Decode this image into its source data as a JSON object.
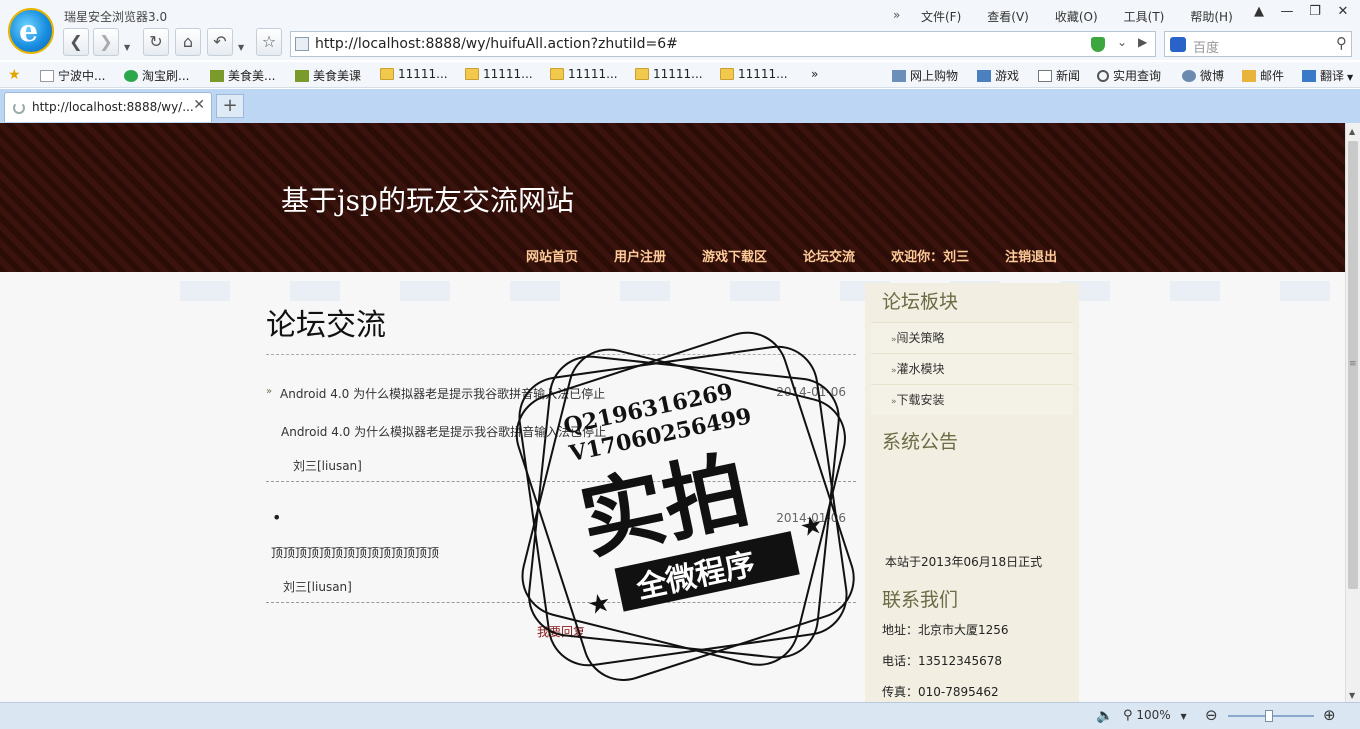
{
  "browser": {
    "app_title": "瑞星安全浏览器3.0",
    "menus": [
      "文件(F)",
      "查看(V)",
      "收藏(O)",
      "工具(T)",
      "帮助(H)"
    ],
    "menu_more": "»",
    "url": "http://localhost:8888/wy/huifuAll.action?zhutiId=6#",
    "search_placeholder": "百度",
    "favorites": [
      {
        "label": "宁波中...",
        "icon": "page-icon"
      },
      {
        "label": "淘宝刷...",
        "icon": "taobao-icon"
      },
      {
        "label": "美食美...",
        "icon": "site-icon"
      },
      {
        "label": "美食美课",
        "icon": "site-icon"
      },
      {
        "label": "11111...",
        "icon": "folder-icon"
      },
      {
        "label": "11111...",
        "icon": "folder-icon"
      },
      {
        "label": "11111...",
        "icon": "folder-icon"
      },
      {
        "label": "11111...",
        "icon": "folder-icon"
      },
      {
        "label": "11111...",
        "icon": "folder-icon"
      }
    ],
    "fav_more": "»",
    "quick_links": [
      "网上购物",
      "游戏",
      "新闻",
      "实用查询",
      "微博",
      "邮件",
      "翻译"
    ],
    "tab_title": "http://localhost:8888/wy/...",
    "zoom": "100%"
  },
  "site": {
    "title": "基于jsp的玩友交流网站",
    "nav": [
      "网站首页",
      "用户注册",
      "游戏下载区",
      "论坛交流",
      "欢迎你：刘三",
      "注销退出"
    ]
  },
  "main": {
    "heading": "论坛交流",
    "post1": {
      "title": "Android 4.0 为什么模拟器老是提示我谷歌拼音输入法已停止",
      "date": "2014-01-06",
      "body": "Android 4.0 为什么模拟器老是提示我谷歌拼音输入法已停止",
      "author": "刘三[liusan]"
    },
    "post2": {
      "bullet": "•",
      "date": "2014-01-06",
      "body": "顶顶顶顶顶顶顶顶顶顶顶顶顶顶",
      "author": "刘三[liusan]"
    },
    "reply_link": "我要回复"
  },
  "sidebar": {
    "board_heading": "论坛板块",
    "boards": [
      "闯关策略",
      "灌水模块",
      "下载安装"
    ],
    "notice_heading": "系统公告",
    "notice_text": "本站于2013年06月18日正式",
    "contact_heading": "联系我们",
    "address": "地址：北京市大厦1256",
    "phone": "电话：13512345678",
    "fax": "传真：010-7895462"
  },
  "watermark": {
    "line1": "Q2196316269",
    "line2": "V17060256499",
    "big": "实拍",
    "banner": "全微程序"
  },
  "colors": {
    "header_bg": "#2b0c07",
    "nav_text": "#ffcc99",
    "reply_link": "#8b1a1a",
    "sidebar_bg": "#f2efe2",
    "tabbar_bg": "#bcd6f3"
  }
}
